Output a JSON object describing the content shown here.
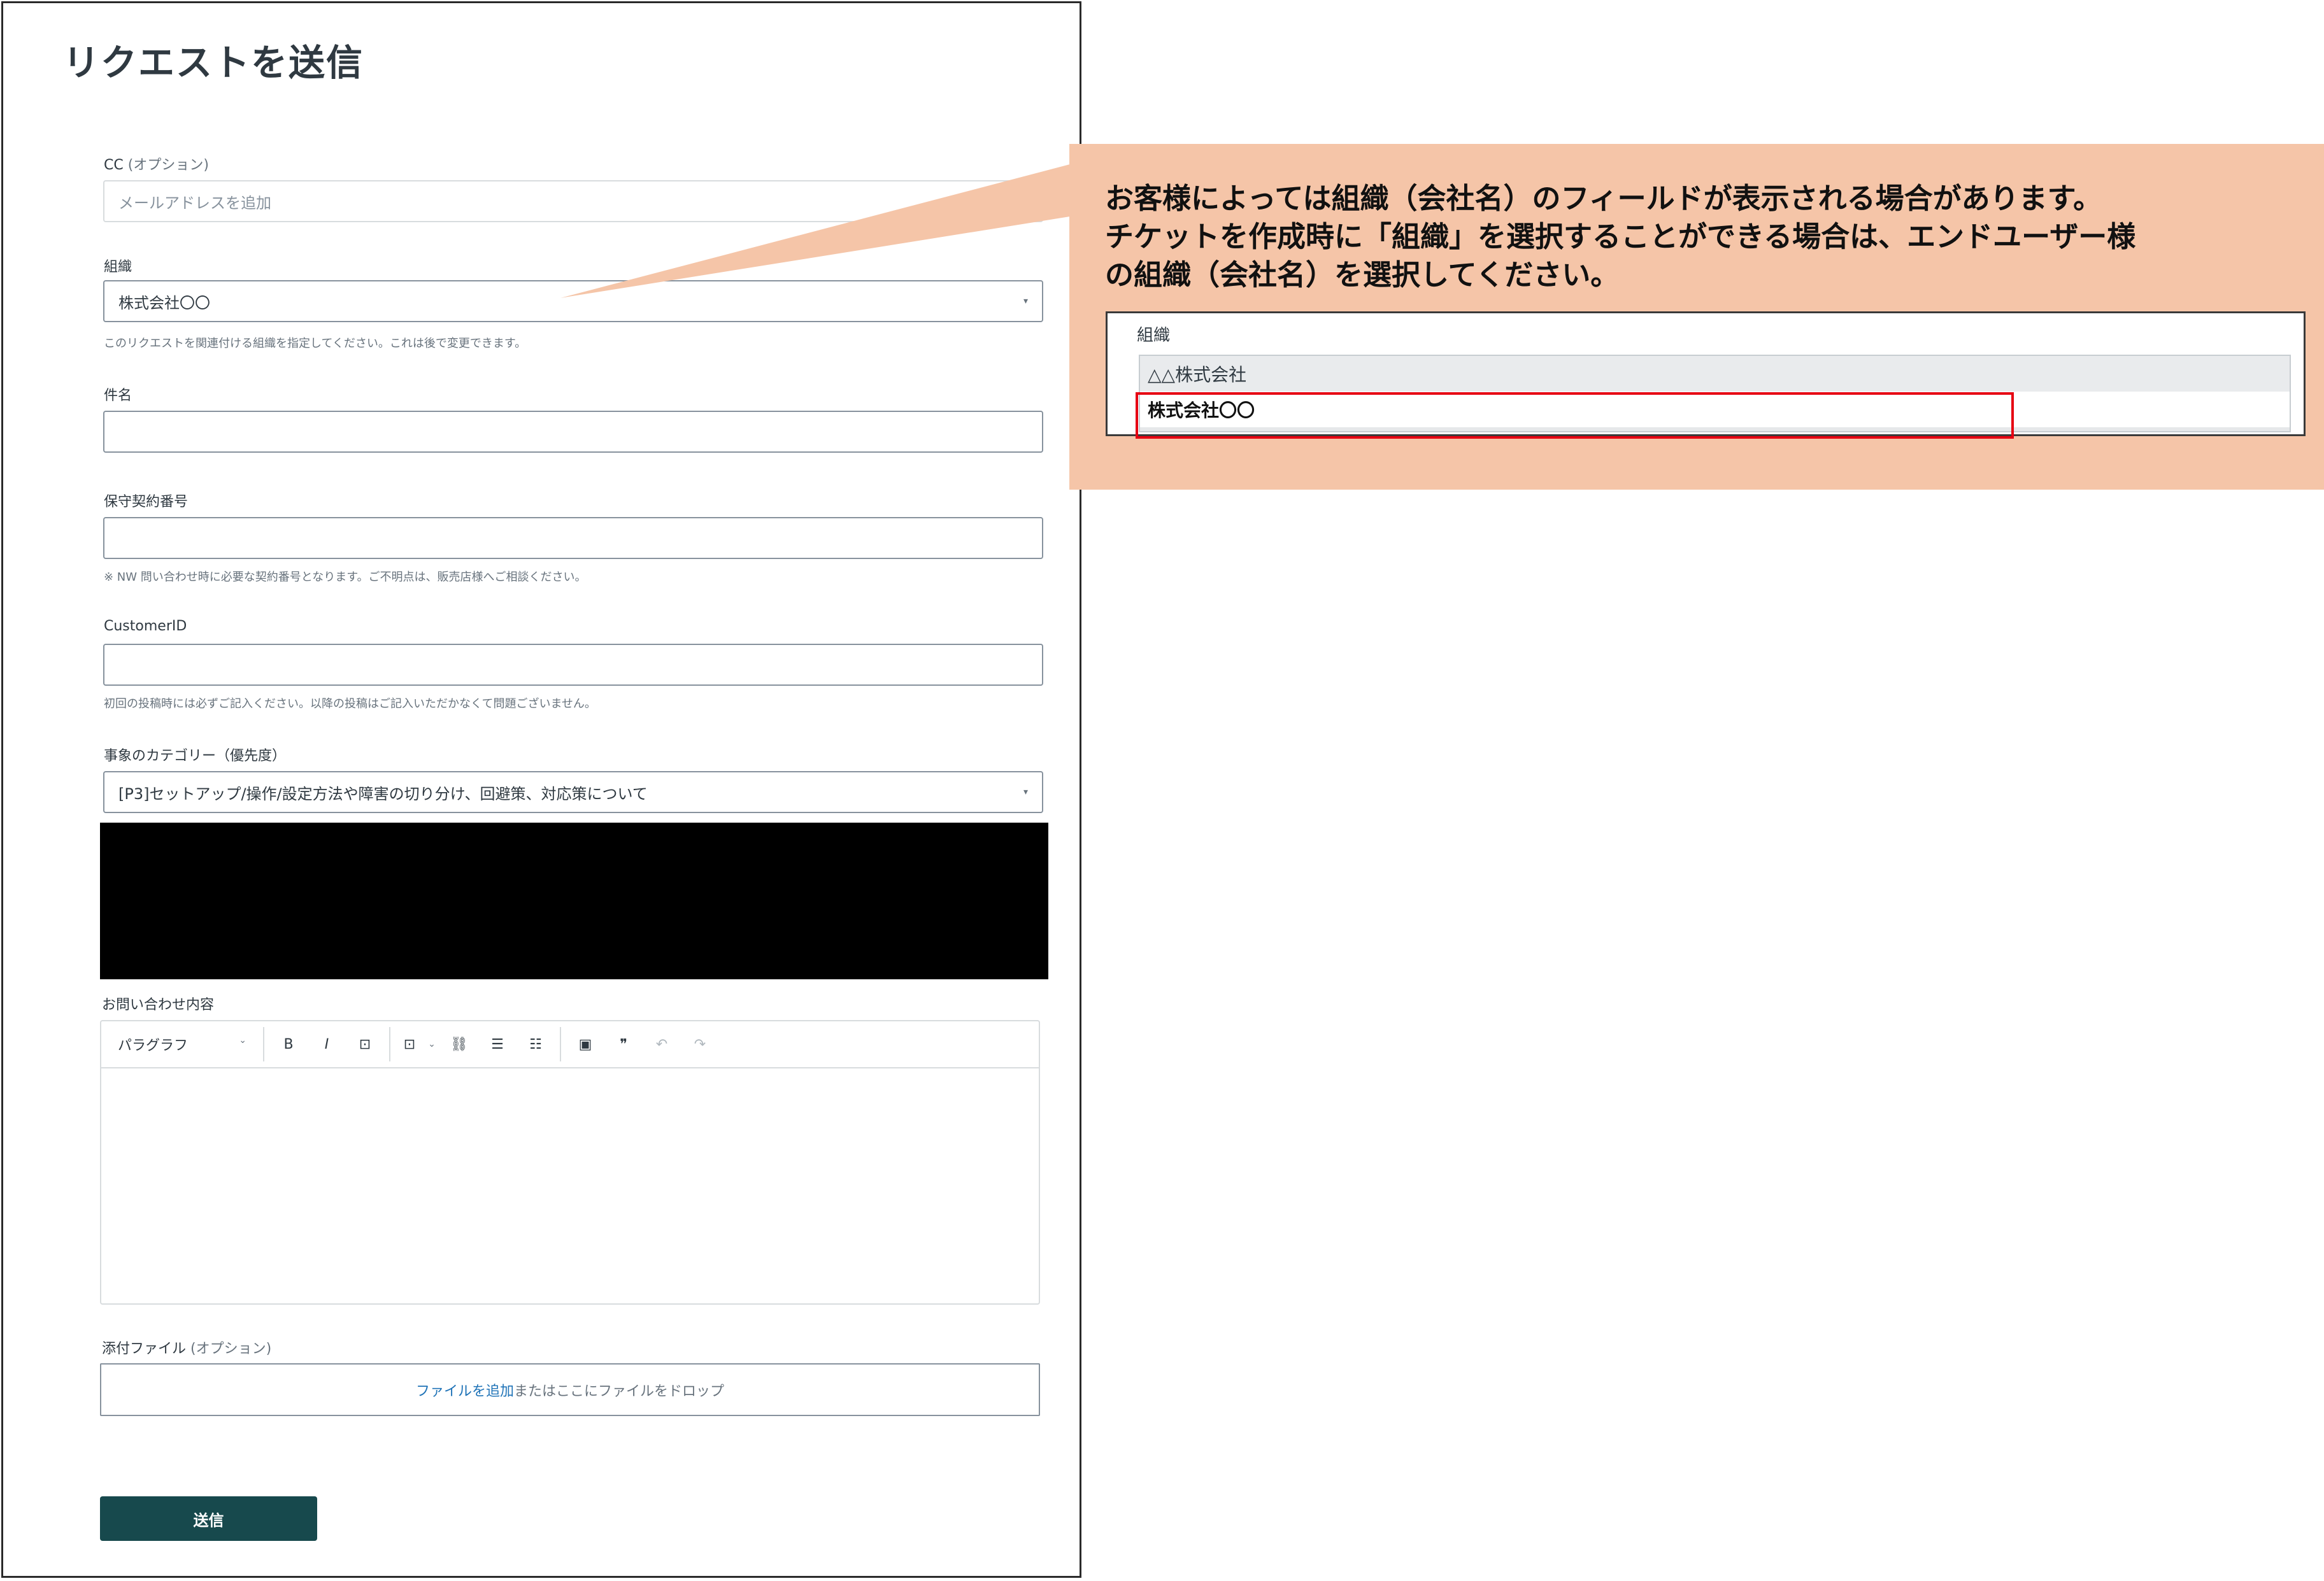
{
  "page": {
    "title": "リクエストを送信"
  },
  "fields": {
    "cc": {
      "label": "CC",
      "optional": "(オプション)",
      "placeholder": "メールアドレスを追加"
    },
    "organization": {
      "label": "組織",
      "value": "株式会社〇〇",
      "hint": "このリクエストを関連付ける組織を指定してください。これは後で変更できます。"
    },
    "subject": {
      "label": "件名"
    },
    "contract": {
      "label": "保守契約番号",
      "hint": "※ NW 問い合わせ時に必要な契約番号となります。ご不明点は、販売店様へご相談ください。"
    },
    "customer_id": {
      "label": "CustomerID",
      "hint": "初回の投稿時には必ずご記入ください。以降の投稿はご記入いただかなくて問題ございません。"
    },
    "category": {
      "label": "事象のカテゴリー（優先度）",
      "value": "[P3]セットアップ/操作/設定方法や障害の切り分け、回避策、対応策について"
    },
    "description": {
      "label": "お問い合わせ内容"
    },
    "attachments": {
      "label": "添付ファイル",
      "optional": "(オプション)",
      "link": "ファイルを追加",
      "rest": "またはここにファイルをドロップ"
    }
  },
  "editor": {
    "format_select": "パラグラフ",
    "tools": {
      "bold": "B",
      "italic": "I",
      "code": "⊡",
      "codeblock": "⊡",
      "link": "⛓",
      "bullets": "☰",
      "numbered": "☷",
      "image": "▣",
      "quote": "❞",
      "undo": "↶",
      "redo": "↷"
    }
  },
  "submit": {
    "label": "送信"
  },
  "callout": {
    "lines": [
      "お客様によっては組織（会社名）のフィールドが表示される場合があります。",
      "チケットを作成時に「組織」を選択することができる場合は、エンドユーザー様",
      "の組織（会社名）を選択してください。"
    ],
    "dropdown": {
      "label": "組織",
      "options": [
        "△△株式会社",
        "株式会社〇〇"
      ]
    }
  },
  "icons": {
    "caret": "▾",
    "chevron": "⌄"
  },
  "colors": {
    "submit_bg": "#17494d",
    "callout_bg": "#f5c5a8",
    "highlight": "#e60012",
    "link": "#1f73b7"
  }
}
